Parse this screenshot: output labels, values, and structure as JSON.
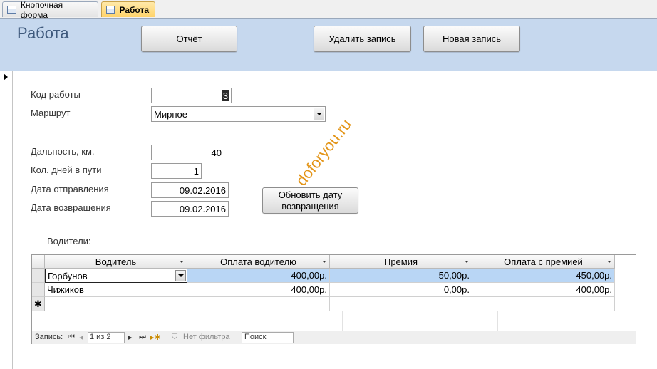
{
  "tabs": [
    {
      "label": "Кнопочная форма"
    },
    {
      "label": "Работа"
    }
  ],
  "form": {
    "title": "Работа",
    "buttons": {
      "report": "Отчёт",
      "delete": "Удалить запись",
      "new": "Новая запись",
      "update_date_line1": "Обновить дату",
      "update_date_line2": "возвращения"
    },
    "fields": {
      "job_code": {
        "label": "Код работы",
        "value": "3"
      },
      "route": {
        "label": "Маршрут",
        "value": "Мирное"
      },
      "distance": {
        "label": "Дальность, км.",
        "value": "40"
      },
      "days": {
        "label": "Кол. дней в пути",
        "value": "1"
      },
      "departure": {
        "label": "Дата отправления",
        "value": "09.02.2016"
      },
      "return": {
        "label": "Дата возвращения",
        "value": "09.02.2016"
      }
    },
    "watermark": "doforyou.ru"
  },
  "subform": {
    "label": "Водители:",
    "columns": [
      "Водитель",
      "Оплата водителю",
      "Премия",
      "Оплата с премией"
    ],
    "rows": [
      {
        "driver": "Горбунов",
        "pay": "400,00р.",
        "bonus": "50,00р.",
        "total": "450,00р."
      },
      {
        "driver": "Чижиков",
        "pay": "400,00р.",
        "bonus": "0,00р.",
        "total": "400,00р."
      }
    ],
    "new_row_marker": "✱",
    "nav": {
      "record_label": "Запись:",
      "position": "1 из 2",
      "filter": "Нет фильтра",
      "search": "Поиск"
    }
  }
}
